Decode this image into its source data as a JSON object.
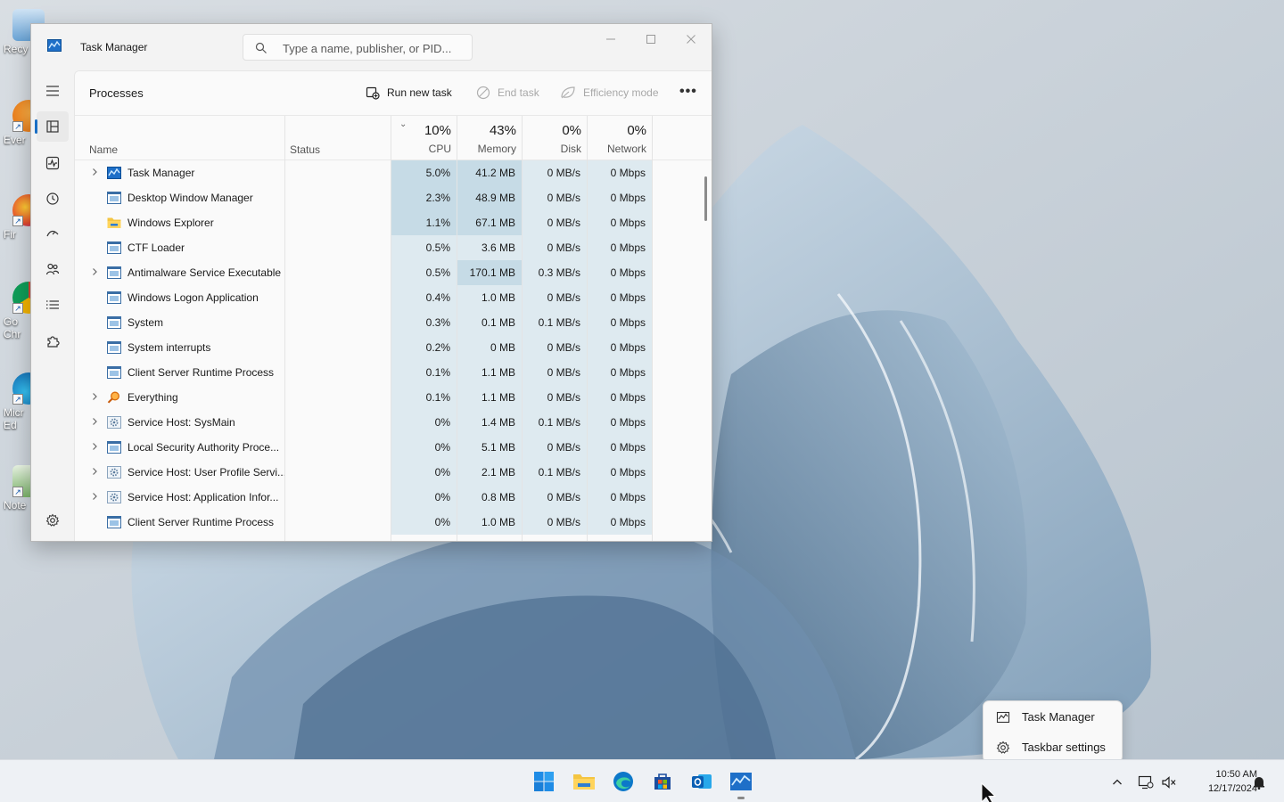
{
  "window": {
    "title": "Task Manager",
    "search_placeholder": "Type a name, publisher, or PID..."
  },
  "commandbar": {
    "page_title": "Processes",
    "run_new_task": "Run new task",
    "end_task": "End task",
    "efficiency_mode": "Efficiency mode",
    "more": "•••"
  },
  "columns": {
    "name": "Name",
    "status": "Status",
    "cpu_pct": "10%",
    "cpu": "CPU",
    "memory_pct": "43%",
    "memory": "Memory",
    "disk_pct": "0%",
    "disk": "Disk",
    "network_pct": "0%",
    "network": "Network"
  },
  "processes": [
    {
      "name": "Task Manager",
      "expandable": true,
      "icon": "task-manager-icon",
      "cpu": "5.0%",
      "memory": "41.2 MB",
      "disk": "0 MB/s",
      "network": "0 Mbps"
    },
    {
      "name": "Desktop Window Manager",
      "expandable": false,
      "icon": "window-app-icon",
      "cpu": "2.3%",
      "memory": "48.9 MB",
      "disk": "0 MB/s",
      "network": "0 Mbps"
    },
    {
      "name": "Windows Explorer",
      "expandable": false,
      "icon": "folder-icon",
      "cpu": "1.1%",
      "memory": "67.1 MB",
      "disk": "0 MB/s",
      "network": "0 Mbps"
    },
    {
      "name": "CTF Loader",
      "expandable": false,
      "icon": "window-app-icon",
      "cpu": "0.5%",
      "memory": "3.6 MB",
      "disk": "0 MB/s",
      "network": "0 Mbps"
    },
    {
      "name": "Antimalware Service Executable",
      "expandable": true,
      "icon": "window-app-icon",
      "cpu": "0.5%",
      "memory": "170.1 MB",
      "disk": "0.3 MB/s",
      "network": "0 Mbps"
    },
    {
      "name": "Windows Logon Application",
      "expandable": false,
      "icon": "window-app-icon",
      "cpu": "0.4%",
      "memory": "1.0 MB",
      "disk": "0 MB/s",
      "network": "0 Mbps"
    },
    {
      "name": "System",
      "expandable": false,
      "icon": "window-app-icon",
      "cpu": "0.3%",
      "memory": "0.1 MB",
      "disk": "0.1 MB/s",
      "network": "0 Mbps"
    },
    {
      "name": "System interrupts",
      "expandable": false,
      "icon": "window-app-icon",
      "cpu": "0.2%",
      "memory": "0 MB",
      "disk": "0 MB/s",
      "network": "0 Mbps"
    },
    {
      "name": "Client Server Runtime Process",
      "expandable": false,
      "icon": "window-app-icon",
      "cpu": "0.1%",
      "memory": "1.1 MB",
      "disk": "0 MB/s",
      "network": "0 Mbps"
    },
    {
      "name": "Everything",
      "expandable": true,
      "icon": "magnifier-icon",
      "cpu": "0.1%",
      "memory": "1.1 MB",
      "disk": "0 MB/s",
      "network": "0 Mbps"
    },
    {
      "name": "Service Host: SysMain",
      "expandable": true,
      "icon": "gear-service-icon",
      "cpu": "0%",
      "memory": "1.4 MB",
      "disk": "0.1 MB/s",
      "network": "0 Mbps"
    },
    {
      "name": "Local Security Authority Proce...",
      "expandable": true,
      "icon": "window-app-icon",
      "cpu": "0%",
      "memory": "5.1 MB",
      "disk": "0 MB/s",
      "network": "0 Mbps"
    },
    {
      "name": "Service Host: User Profile Servi...",
      "expandable": true,
      "icon": "gear-service-icon",
      "cpu": "0%",
      "memory": "2.1 MB",
      "disk": "0.1 MB/s",
      "network": "0 Mbps"
    },
    {
      "name": "Service Host: Application Infor...",
      "expandable": true,
      "icon": "gear-service-icon",
      "cpu": "0%",
      "memory": "0.8 MB",
      "disk": "0 MB/s",
      "network": "0 Mbps"
    },
    {
      "name": "Client Server Runtime Process",
      "expandable": false,
      "icon": "window-app-icon",
      "cpu": "0%",
      "memory": "1.0 MB",
      "disk": "0 MB/s",
      "network": "0 Mbps"
    }
  ],
  "desktop_icons": [
    {
      "label": "Recy",
      "icon": "recycle-bin-icon"
    },
    {
      "label": "Ever",
      "icon": "everything-shortcut-icon"
    },
    {
      "label": "Fir",
      "icon": "firefox-shortcut-icon"
    },
    {
      "label": "Go\nChr",
      "icon": "chrome-shortcut-icon"
    },
    {
      "label": "Micr\nEd",
      "icon": "edge-shortcut-icon"
    },
    {
      "label": "Note",
      "icon": "notepad-shortcut-icon"
    }
  ],
  "context_menu": {
    "items": [
      {
        "label": "Task Manager",
        "icon": "task-manager-icon"
      },
      {
        "label": "Taskbar settings",
        "icon": "gear-icon"
      }
    ]
  },
  "taskbar": {
    "time": "10:50 AM",
    "date": "12/17/2024"
  },
  "colors": {
    "accent": "#1a6fc4",
    "heat_strong": "#c6dbe6",
    "heat_light": "#deeaf0",
    "wallpaper_bg": "#c8d2dc"
  }
}
